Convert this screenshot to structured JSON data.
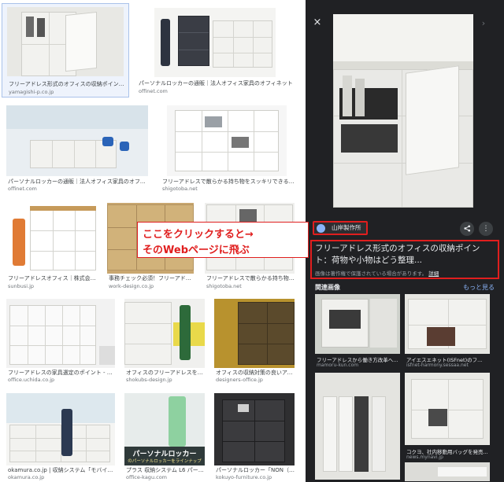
{
  "grid": {
    "rows": [
      [
        {
          "caption": "フリーアドレス形式のオフィスの収納ポイント：荷...",
          "source": "yamagishi-p.co.jp"
        },
        {
          "caption": "パーソナルロッカーの通販｜法人オフィス家具のオフィネット",
          "source": "offinet.com"
        }
      ],
      [
        {
          "caption": "パーソナルロッカーの通販｜法人オフィス家具のオフィネット",
          "source": "offinet.com"
        },
        {
          "caption": "フリーアドレスで散らかる持ち物をスッキリできるオフィ...",
          "source": "shigotoba.net"
        }
      ],
      [
        {
          "caption": "フリーアドレスオフィス｜株式会社...",
          "source": "sunbusi.jp"
        },
        {
          "caption": "事務チェック必須！フリーアドレスに...",
          "source": "work-design.co.jp"
        },
        {
          "caption": "フリーアドレスで散らかる持ち物をスッキ...",
          "source": "shigotoba.net"
        }
      ],
      [
        {
          "caption": "フリーアドレスの家具選定のポイント - オフィ...",
          "source": "office.uchida.co.jp"
        },
        {
          "caption": "オフィスのフリーアドレスを快適...",
          "source": "shokubs-design.jp"
        },
        {
          "caption": "オフィスの収納対策の良いアイテ...",
          "source": "designers-office.jp"
        }
      ],
      [
        {
          "caption": "okamura.co.jp | 収納システム「モバイル収...",
          "source": "okamura.co.jp"
        },
        {
          "caption": "プラス 収納システム L6 パーソナル...",
          "source": "office-kagu.com"
        },
        {
          "caption": "パーソナルロッカー「NON（イノン...",
          "source": "kokuyo-furniture.co.jp"
        }
      ]
    ],
    "ad_banner": {
      "title": "パーソナルロッカー",
      "subtitle": "のパーソナルロッカーをラインナップ"
    }
  },
  "panel": {
    "close_icon": "×",
    "prev_icon": "‹",
    "next_icon": "›",
    "site_name": "山岸製作所",
    "share_icon": "share-icon",
    "more_icon": "⋮",
    "title": "フリーアドレス形式のオフィスの収納ポイント：荷物や小物はどう整理...",
    "copyright": "画像は著作権で保護されている場合があります。",
    "copyright_more": "詳細",
    "related_heading": "関連画像",
    "related_more": "もっと見る",
    "related": [
      {
        "caption": "フリーアドレスから働き方改革へ...",
        "source": "mamoru-kun.com"
      },
      {
        "caption": "アイエスエネット(ISFnet)のフ...",
        "source": "isfnet-harmony.sessaa.net"
      },
      {
        "caption": "",
        "source": ""
      },
      {
        "caption": "コクヨ、社内移動用バッグを発売...",
        "source": "news.mynavi.jp"
      }
    ]
  },
  "annotation": {
    "line1": "ここをクリックすると→",
    "line2": "そのWebページに飛ぶ"
  },
  "colors": {
    "accent_red": "#e01e1e",
    "panel_bg": "#202124",
    "link_blue": "#8ab4f8"
  }
}
